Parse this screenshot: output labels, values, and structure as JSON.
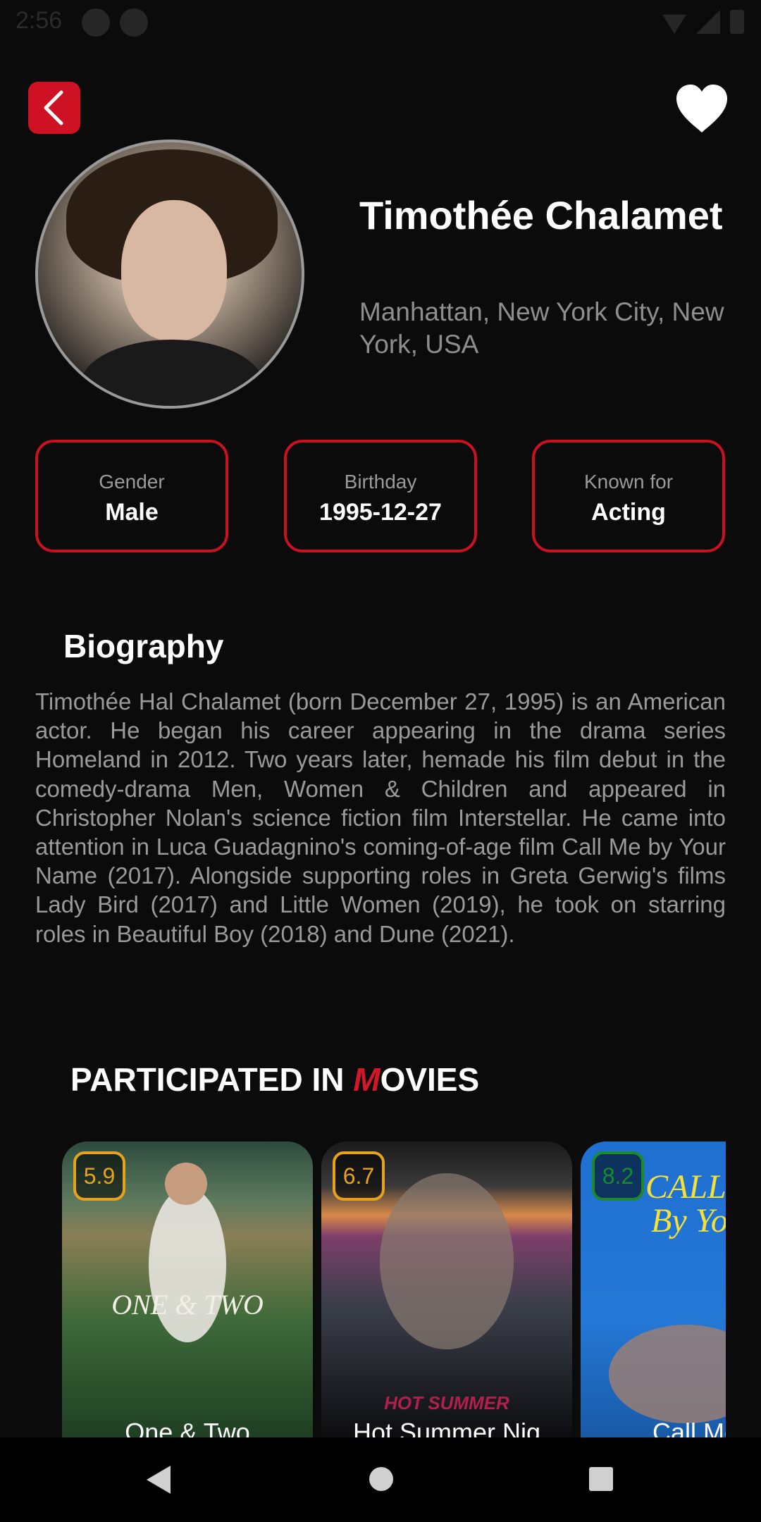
{
  "status_bar": {
    "time": "2:56"
  },
  "profile": {
    "name": "Timothée Chalamet",
    "location": "Manhattan, New York City, New York, USA"
  },
  "info": [
    {
      "label": "Gender",
      "value": "Male"
    },
    {
      "label": "Birthday",
      "value": "1995-12-27"
    },
    {
      "label": "Known for",
      "value": "Acting"
    }
  ],
  "biography": {
    "heading": "Biography",
    "text": "Timothée Hal Chalamet (born December 27, 1995) is an American actor. He began his career appearing in the drama series Homeland in 2012. Two years later, hemade his film debut in the comedy-drama Men, Women & Children and appeared in Christopher Nolan's science fiction film Interstellar. He came into attention in Luca Guadagnino's coming-of-age film Call Me by Your Name (2017). Alongside supporting roles in Greta Gerwig's films Lady Bird (2017) and Little Women (2019), he took on starring roles in Beautiful Boy (2018) and Dune (2021)."
  },
  "movies_section": {
    "heading_part1": "PARTICIPATED IN ",
    "heading_m": "M",
    "heading_part2": "OVIES"
  },
  "movies": [
    {
      "title": "One & Two",
      "rating": "5.9",
      "rating_color": "#e6a21a",
      "poster_text": "ONE & TWO"
    },
    {
      "title": "Hot Summer Nig",
      "rating": "6.7",
      "rating_color": "#e6a21a",
      "poster_text": "HOT SUMMER NIGHTS"
    },
    {
      "title": "Call Me b",
      "rating": "8.2",
      "rating_color": "#1a8a2a",
      "poster_text": "CALL ME BY YOUR NAME"
    }
  ],
  "colors": {
    "accent": "#c8121f",
    "background": "#0b0b0c"
  }
}
